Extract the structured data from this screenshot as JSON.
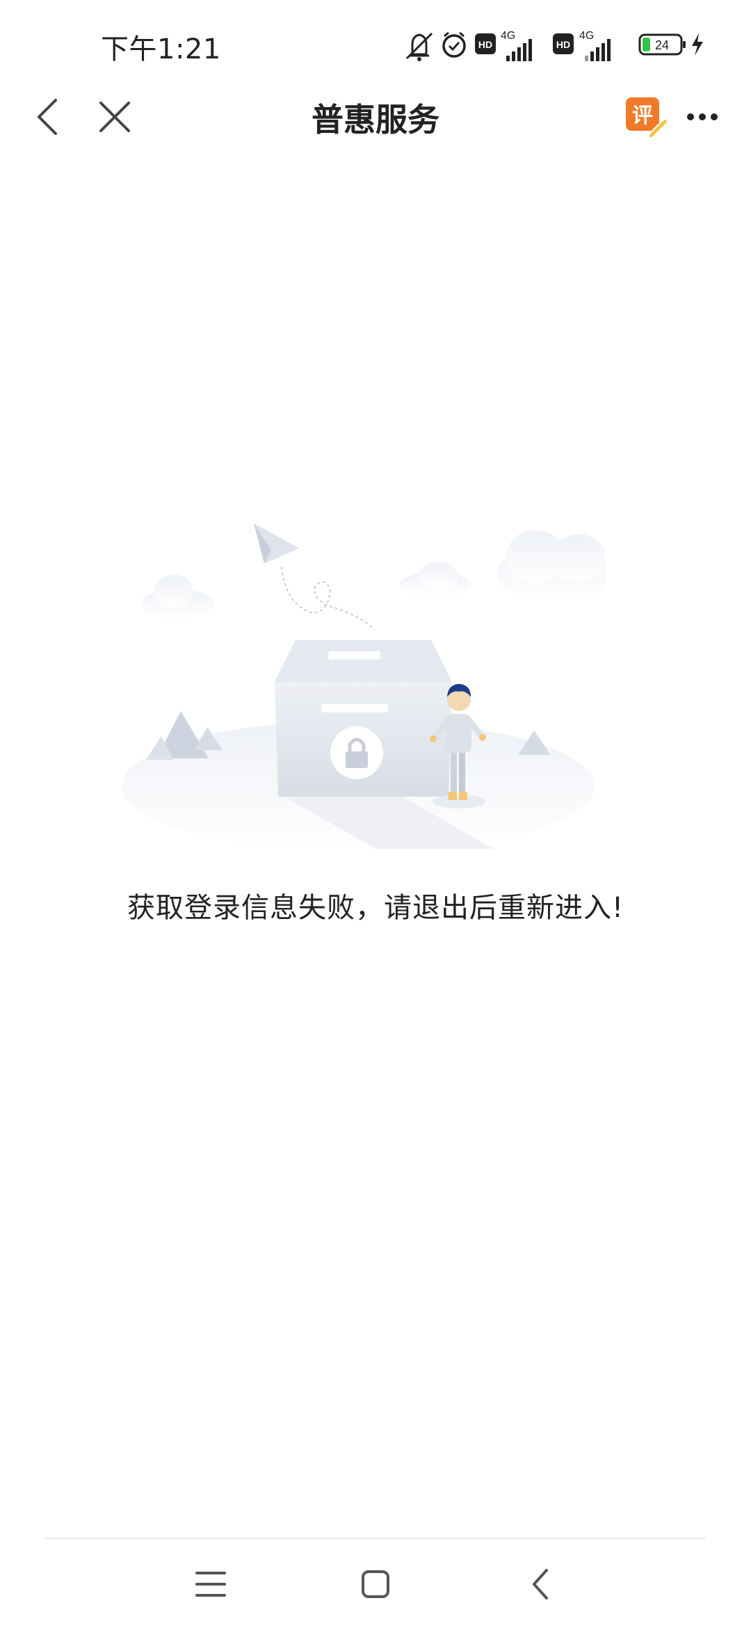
{
  "status_bar": {
    "time": "下午1:21",
    "network_1": "4G",
    "network_2": "4G",
    "hd_label": "HD",
    "battery_level": "24",
    "icons": [
      "mute-bell-icon",
      "alarm-icon",
      "hd-icon",
      "signal-icon",
      "hd-icon",
      "signal-icon",
      "battery-icon",
      "charging-icon"
    ]
  },
  "nav": {
    "title": "普惠服务",
    "review_label": "评",
    "icons": [
      "back-icon",
      "close-icon",
      "review-icon",
      "more-icon"
    ]
  },
  "content": {
    "error_message": "获取登录信息失败，请退出后重新进入!"
  },
  "system_nav": {
    "icons": [
      "menu-icon",
      "home-icon",
      "back-icon"
    ]
  },
  "colors": {
    "accent_orange": "#f07a2a",
    "text_primary": "#222222",
    "illustration_gray": "#e3e7ee",
    "person_hair": "#1e3a8a"
  }
}
